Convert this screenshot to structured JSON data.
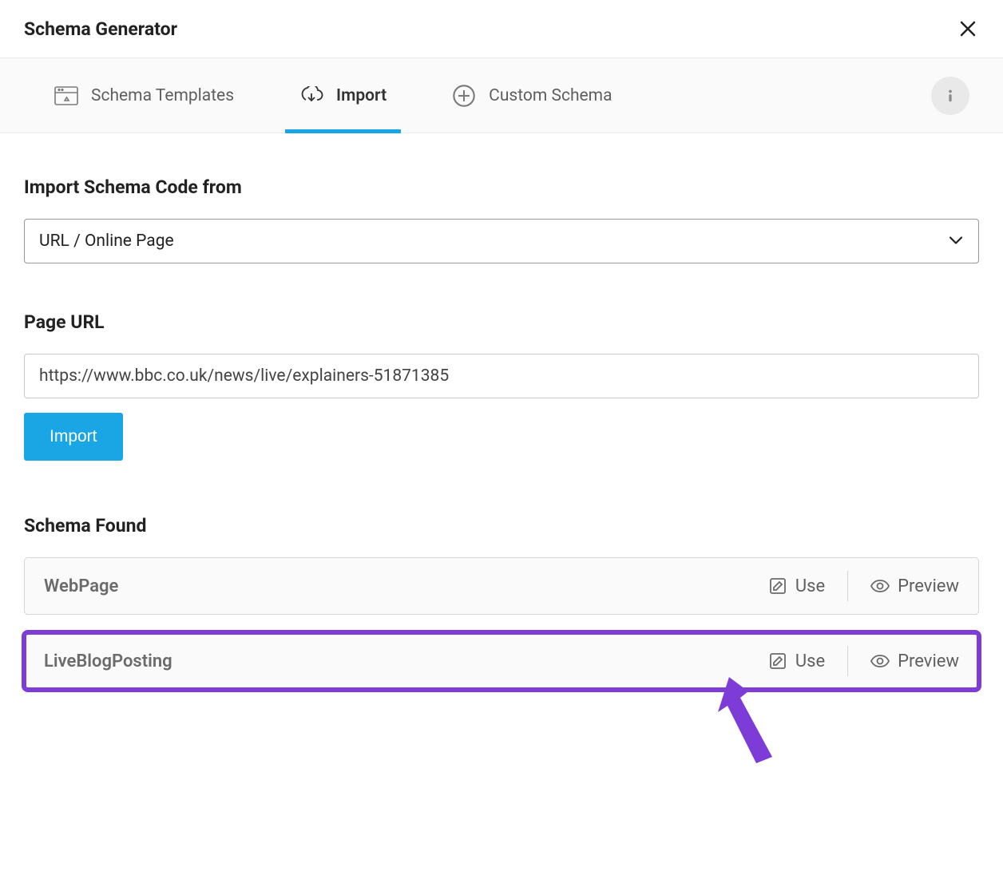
{
  "header": {
    "title": "Schema Generator"
  },
  "tabs": [
    {
      "label": "Schema Templates",
      "active": false,
      "icon": "template"
    },
    {
      "label": "Import",
      "active": true,
      "icon": "import"
    },
    {
      "label": "Custom Schema",
      "active": false,
      "icon": "plus"
    }
  ],
  "importForm": {
    "sourceLabel": "Import Schema Code from",
    "sourceValue": "URL / Online Page",
    "urlLabel": "Page URL",
    "urlValue": "https://www.bbc.co.uk/news/live/explainers-51871385",
    "submitLabel": "Import"
  },
  "found": {
    "label": "Schema Found",
    "actionUse": "Use",
    "actionPreview": "Preview",
    "items": [
      {
        "name": "WebPage",
        "highlight": false
      },
      {
        "name": "LiveBlogPosting",
        "highlight": true
      }
    ]
  }
}
